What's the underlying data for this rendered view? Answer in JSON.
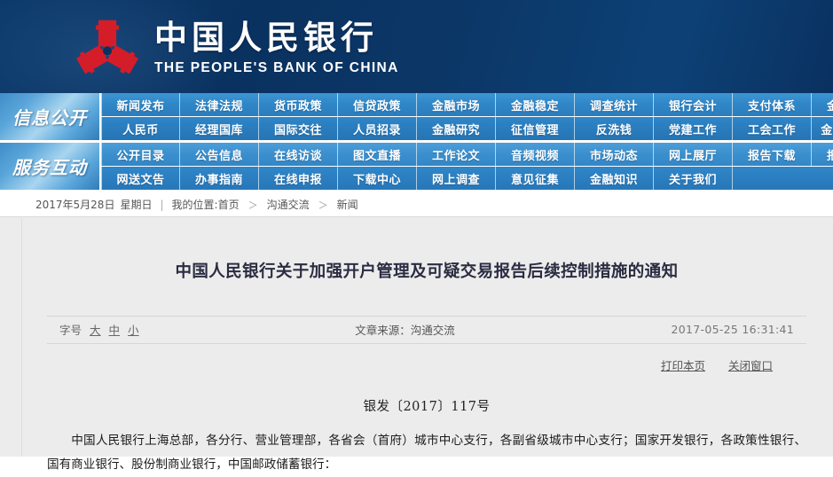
{
  "header": {
    "logo_icon": "pboc-emblem-icon",
    "brand_cn": "中国人民银行",
    "brand_en": "THE PEOPLE'S BANK OF CHINA",
    "bg_color": "#0a3260"
  },
  "nav": {
    "blocks": [
      {
        "label": "信息公开",
        "rows": [
          [
            "新闻发布",
            "法律法规",
            "货币政策",
            "信贷政策",
            "金融市场",
            "金融稳定",
            "调查统计",
            "银行会计",
            "支付体系",
            "金融科技"
          ],
          [
            "人民币",
            "经理国库",
            "国际交往",
            "人员招录",
            "金融研究",
            "征信管理",
            "反洗钱",
            "党建工作",
            "工会工作",
            "金融标准化"
          ]
        ]
      },
      {
        "label": "服务互动",
        "rows": [
          [
            "公开目录",
            "公告信息",
            "在线访谈",
            "图文直播",
            "工作论文",
            "音频视频",
            "市场动态",
            "网上展厅",
            "报告下载",
            "报刊年鉴"
          ],
          [
            "网送文告",
            "办事指南",
            "在线申报",
            "下载中心",
            "网上调查",
            "意见征集",
            "金融知识",
            "关于我们"
          ]
        ]
      }
    ],
    "accent_color": "#2f86c7"
  },
  "breadcrumb": {
    "date": "2017年5月28日",
    "weekday": "星期日",
    "separator": "|",
    "location_label": "我的位置:",
    "items": [
      "首页",
      "沟通交流",
      "新闻"
    ],
    "arrow": "＞"
  },
  "article": {
    "title": "中国人民银行关于加强开户管理及可疑交易报告后续控制措施的通知",
    "fontsize": {
      "label": "字号",
      "options": [
        "大",
        "中",
        "小"
      ]
    },
    "source": "文章来源：沟通交流",
    "time": "2017-05-25 16:31:41",
    "tools": [
      "打印本页",
      "关闭窗口"
    ],
    "doc_number": "银发〔2017〕117号",
    "body": "中国人民银行上海总部，各分行、营业管理部，各省会（首府）城市中心支行，各副省级城市中心支行；国家开发银行，各政策性银行、国有商业银行、股份制商业银行，中国邮政储蓄银行："
  }
}
